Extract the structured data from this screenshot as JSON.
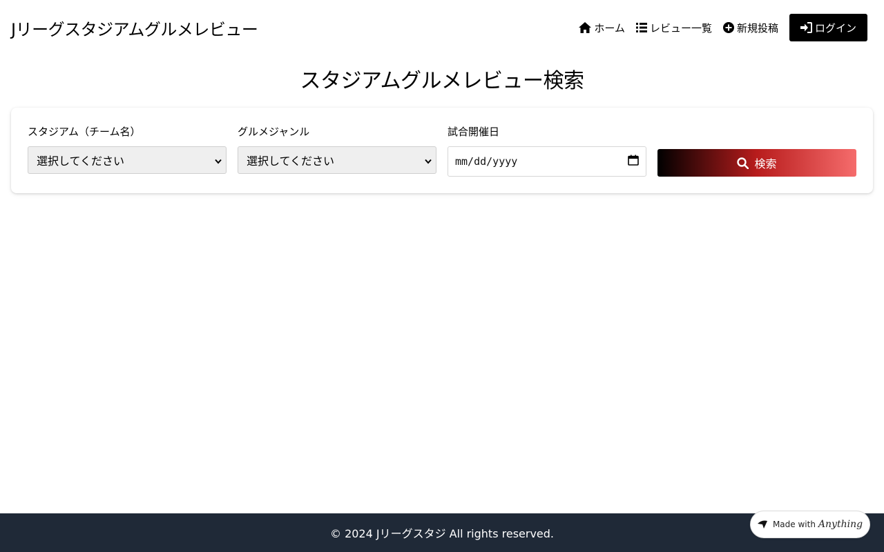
{
  "header": {
    "site_title": "Jリーグスタジアムグルメレビュー",
    "nav": [
      {
        "label": "ホーム",
        "icon": "home-icon"
      },
      {
        "label": "レビュー一覧",
        "icon": "list-icon"
      },
      {
        "label": "新規投稿",
        "icon": "plus-circle-icon"
      }
    ],
    "login_label": "ログイン",
    "login_icon": "sign-in-icon"
  },
  "main": {
    "heading": "スタジアムグルメレビュー検索",
    "search_form": {
      "stadium_label": "スタジアム（チーム名）",
      "stadium_value": "選択してください",
      "genre_label": "グルメジャンル",
      "genre_value": "選択してください",
      "date_label": "試合開催日",
      "date_placeholder": "mm/dd/yyyy",
      "search_label": "検索"
    }
  },
  "footer": {
    "copyright": "© 2024 Jリーグスタジ All rights reserved."
  },
  "badge": {
    "made_with": "Made with",
    "brand": "Anything"
  },
  "colors": {
    "footer_bg": "#1f2937",
    "login_bg": "#000000",
    "search_gradient_start": "#000000",
    "search_gradient_end": "#f56c6c"
  }
}
